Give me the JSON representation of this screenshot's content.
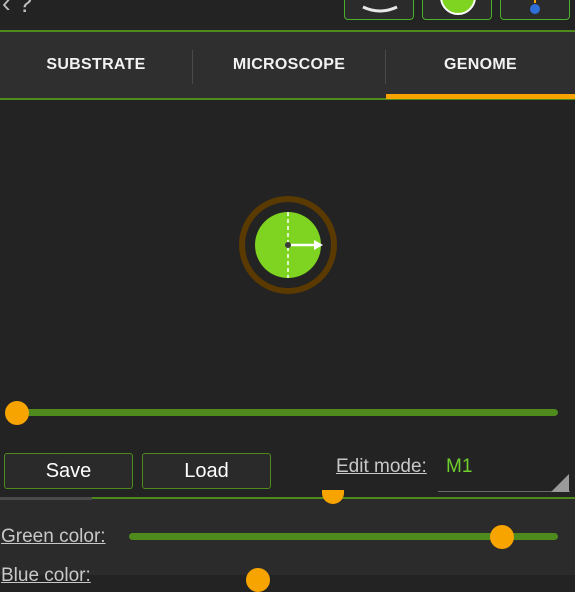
{
  "topbar": {
    "back_glyph": "‹ ?",
    "tools": [
      "dish-icon",
      "cell-icon",
      "dropper-icon"
    ]
  },
  "tabs": [
    {
      "label": "SUBSTRATE",
      "active": false
    },
    {
      "label": "MICROSCOPE",
      "active": false
    },
    {
      "label": "GENOME",
      "active": true
    }
  ],
  "colors": {
    "accent": "#f7a400",
    "green": "#4e8a1c",
    "cell_fill": "#7fd321",
    "value_green": "#6fcf2d",
    "background": "#232323"
  },
  "cell_preview": {
    "direction_icon": "arrow-right-icon"
  },
  "main_slider": {
    "value": 0.0
  },
  "actions": {
    "save_label": "Save",
    "load_label": "Load"
  },
  "edit_mode": {
    "label": "Edit mode:",
    "value": "M1"
  },
  "color_controls": {
    "green_label": "Green color:",
    "green_value": 0.87,
    "blue_label": "Blue color:",
    "blue_value": 0.3
  }
}
